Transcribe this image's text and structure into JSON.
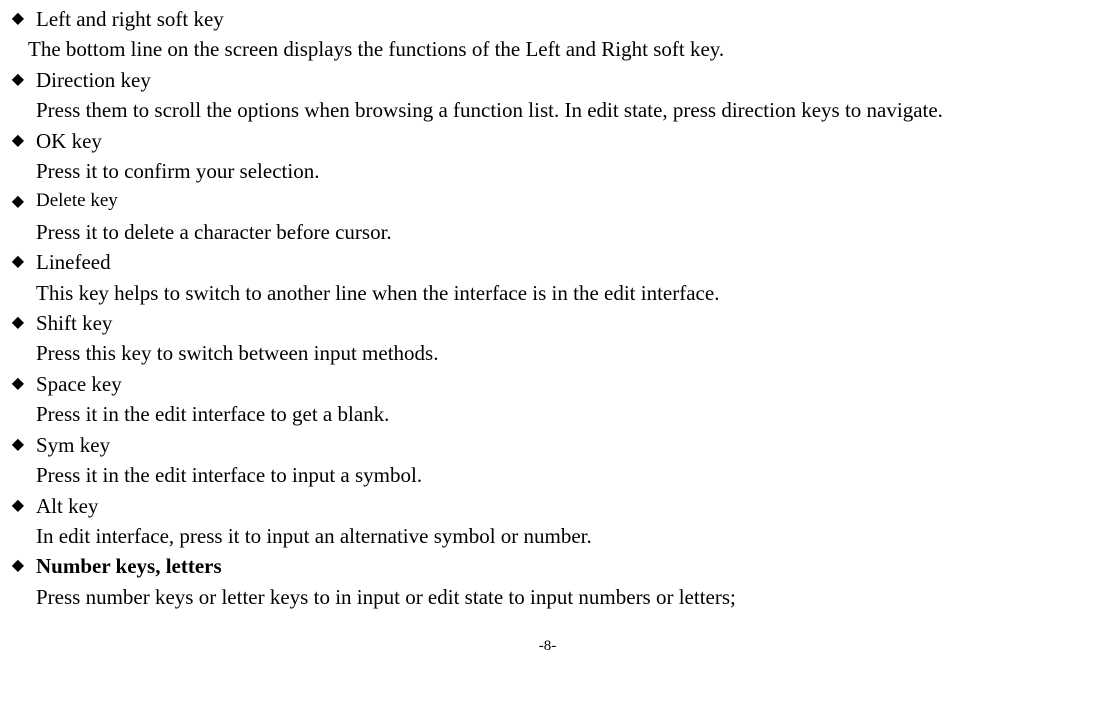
{
  "items": [
    {
      "title": "Left and right soft key",
      "body": "The bottom line on the screen displays the functions of the Left and Right soft key.",
      "bodyIndent": "alt",
      "bold": false
    },
    {
      "title": "Direction key",
      "body": "Press them to scroll the options when browsing a function list. In edit state, press direction keys to navigate.",
      "bodyIndent": "normal",
      "bold": false
    },
    {
      "title": "OK key",
      "body": " Press it to confirm your selection.",
      "bodyIndent": "normal",
      "bold": false
    },
    {
      "title": "Delete key",
      "body": "Press it to delete a character before cursor.",
      "bodyIndent": "normal",
      "bold": false,
      "titleSmall": true
    },
    {
      "title": "Linefeed",
      "body": "This key helps to switch to another line when the interface is in the edit interface.",
      "bodyIndent": "normal",
      "bold": false
    },
    {
      "title": "Shift key",
      "body": "Press this key to switch between input methods.",
      "bodyIndent": "normal",
      "bold": false
    },
    {
      "title": "Space key",
      "body": "Press it in the edit interface to get a blank.",
      "bodyIndent": "normal",
      "bold": false
    },
    {
      "title": "Sym key",
      "body": "Press it in the edit interface to input a symbol.",
      "bodyIndent": "normal",
      "bold": false
    },
    {
      "title": "Alt key",
      "body": " In edit interface, press it to input an alternative symbol or number.",
      "bodyIndent": "normal",
      "bold": false
    },
    {
      "title": "Number keys, letters",
      "body": " Press number keys or letter keys to in input or edit state to input numbers or letters;",
      "bodyIndent": "normal",
      "bold": true
    }
  ],
  "bulletGlyph": "◆",
  "pageNumber": "-8-"
}
